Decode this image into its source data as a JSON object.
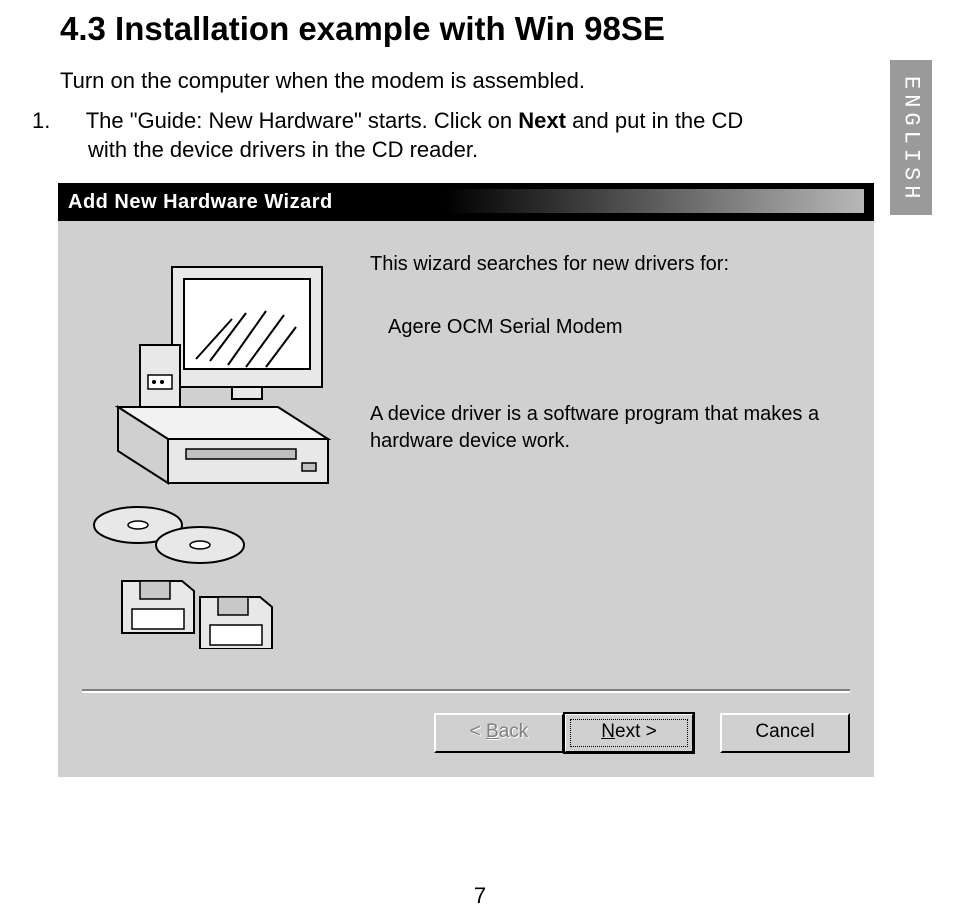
{
  "doc": {
    "heading": "4.3 Installation example with Win 98SE",
    "intro": "Turn on the computer when the modem is assembled.",
    "step_number": "1.",
    "step_text_a": "The \"Guide: New Hardware\" starts. Click on ",
    "step_text_bold": "Next",
    "step_text_b": " and put in the CD with the device drivers in the CD reader.",
    "side_tab": "ENGLISH",
    "page_number": "7"
  },
  "wizard": {
    "title": "Add New Hardware Wizard",
    "line1": "This wizard searches for new drivers for:",
    "device": "Agere OCM Serial Modem",
    "desc": "A device driver is a software program that makes a hardware device work.",
    "buttons": {
      "back_prefix": "< ",
      "back_u": "B",
      "back_rest": "ack",
      "next_u": "N",
      "next_rest": "ext >",
      "cancel": "Cancel"
    }
  }
}
